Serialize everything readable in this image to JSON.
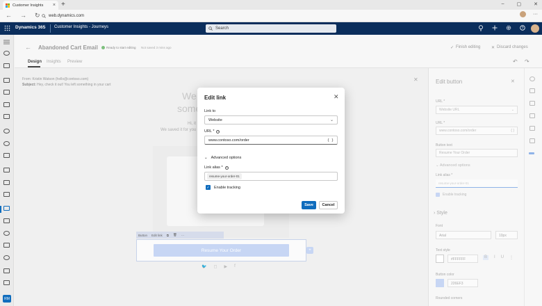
{
  "browser": {
    "tab_title": "Customer Insights",
    "url": "web.dynamics.com"
  },
  "appbar": {
    "brand": "Dynamics 365",
    "app_name": "Customer Insights - Journeys",
    "search_placeholder": "Search"
  },
  "left_rail": {
    "badge": "RM"
  },
  "header": {
    "back_icon": "arrow-left-icon",
    "title": "Abandoned Cart Email",
    "status": "Ready to start editing",
    "saved_text": "Not saved 3 mins ago",
    "finish_label": "Finish editing",
    "discard_label": "Discard changes",
    "tabs": [
      {
        "label": "Design"
      },
      {
        "label": "Insights"
      },
      {
        "label": "Preview"
      }
    ]
  },
  "email": {
    "from_label": "From:",
    "from_value": "Kristin Watson (hello@contoso.com)",
    "subject_label": "Subject:",
    "subject_value": "Hey, check it out! You left something in your cart",
    "headline_1": "We",
    "headline_2": "some",
    "body_1": "Hi, it looks like",
    "body_2": "We saved it for you",
    "toolbar_label": "Button",
    "toolbar_edit": "Edit link",
    "button_text": "Resume Your Order"
  },
  "right_panel": {
    "title": "Edit button",
    "url_label": "URL *",
    "url_type": "Website URL",
    "url2_label": "URL *",
    "url_value": "www.contoso.com/order",
    "button_text_label": "Button text",
    "button_text_value": "Resume Your Order",
    "advanced_label": "Advanced options",
    "alias_label": "Link alias *",
    "alias_value": "resume-your-order-01",
    "tracking_label": "Enable tracking",
    "style_label": "Style",
    "font_label": "Font",
    "font_value": "Arial",
    "font_size": "10px",
    "text_style_label": "Text style",
    "text_color": "#FFFFFF",
    "bold": "B",
    "italic": "I",
    "underline": "U",
    "button_color_label": "Button color",
    "button_color": "226EF3",
    "rounded_label": "Rounded corners"
  },
  "modal": {
    "title": "Edit link",
    "link_to_label": "Link to",
    "link_to_value": "Website",
    "url_label": "URL *",
    "url_value": "www.contoso.com/order",
    "advanced_label": "Advanced options",
    "alias_label": "Link alias *",
    "alias_value": "resume-your-order-01",
    "tracking_label": "Enable tracking",
    "tracking_checked": true,
    "save_label": "Save",
    "cancel_label": "Cancel"
  },
  "colors": {
    "appbar": "#0b2e5c",
    "primary": "#0f6cbd",
    "button_fill_dimmed": "#c7d6f4"
  }
}
